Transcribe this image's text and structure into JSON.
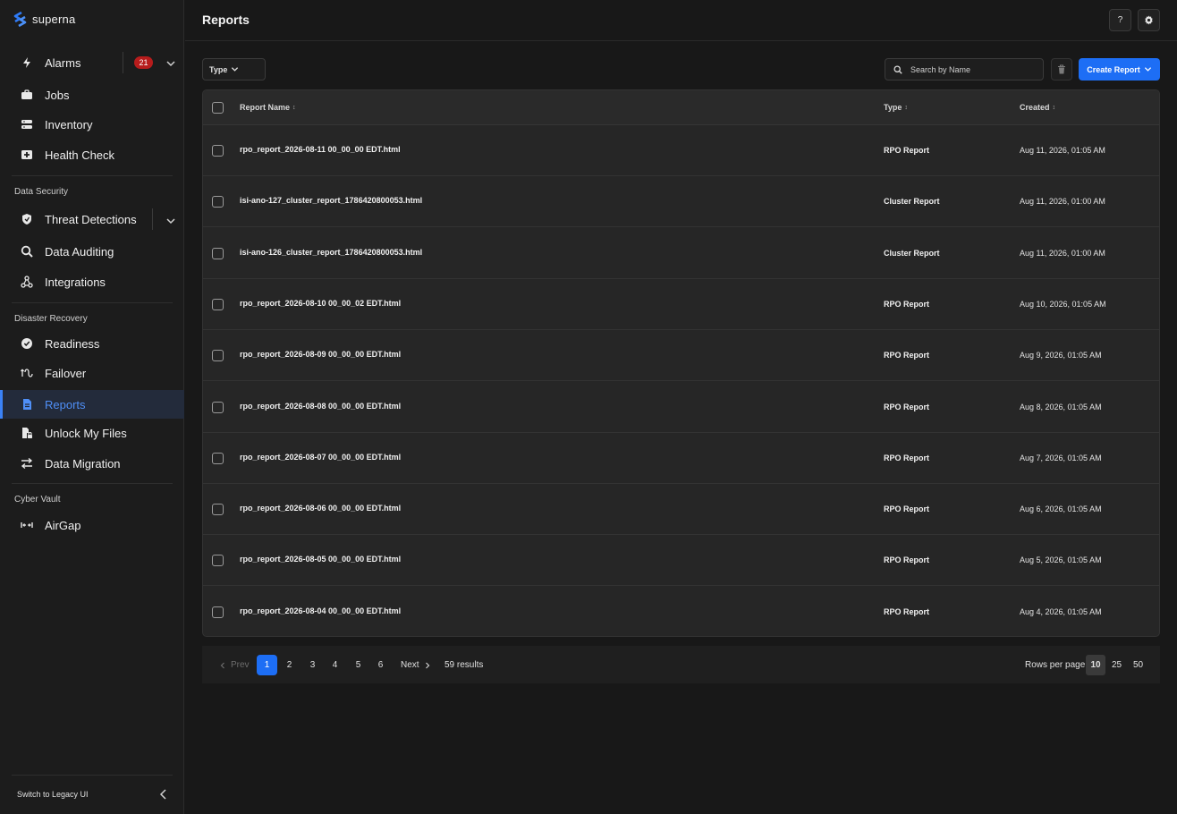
{
  "brand": {
    "name": "superna"
  },
  "sidebar": {
    "items": [
      {
        "label": "Alarms",
        "icon": "lightning-icon",
        "badge": "21"
      },
      {
        "label": "Jobs",
        "icon": "briefcase-icon"
      },
      {
        "label": "Inventory",
        "icon": "server-icon"
      },
      {
        "label": "Health Check",
        "icon": "health-check-icon"
      }
    ],
    "sections": [
      {
        "label": "Data Security",
        "items": [
          {
            "label": "Threat Detections",
            "icon": "shield-icon"
          },
          {
            "label": "Data Auditing",
            "icon": "magnify-icon"
          },
          {
            "label": "Integrations",
            "icon": "integrations-icon"
          }
        ]
      },
      {
        "label": "Disaster Recovery",
        "items": [
          {
            "label": "Readiness",
            "icon": "check-circle-icon"
          },
          {
            "label": "Failover",
            "icon": "failover-icon"
          },
          {
            "label": "Reports",
            "icon": "document-icon",
            "active": true
          },
          {
            "label": "Unlock My Files",
            "icon": "file-lock-icon"
          },
          {
            "label": "Data Migration",
            "icon": "swap-arrows-icon"
          }
        ]
      },
      {
        "label": "Cyber Vault",
        "items": [
          {
            "label": "AirGap",
            "icon": "airgap-icon"
          }
        ]
      }
    ],
    "footer_label": "Switch to Legacy UI"
  },
  "header": {
    "title": "Reports",
    "help_label": "?"
  },
  "toolbar": {
    "type_filter_label": "Type",
    "search_placeholder": "Search by Name",
    "create_label": "Create Report"
  },
  "table": {
    "columns": [
      "Report Name",
      "Type",
      "Created"
    ],
    "rows": [
      {
        "name": "rpo_report_2026-08-11 00_00_00 EDT.html",
        "type": "RPO Report",
        "created": "Aug 11, 2026, 01:05 AM"
      },
      {
        "name": "isi-ano-127_cluster_report_1786420800053.html",
        "type": "Cluster Report",
        "created": "Aug 11, 2026, 01:00 AM"
      },
      {
        "name": "isi-ano-126_cluster_report_1786420800053.html",
        "type": "Cluster Report",
        "created": "Aug 11, 2026, 01:00 AM"
      },
      {
        "name": "rpo_report_2026-08-10 00_00_02 EDT.html",
        "type": "RPO Report",
        "created": "Aug 10, 2026, 01:05 AM"
      },
      {
        "name": "rpo_report_2026-08-09 00_00_00 EDT.html",
        "type": "RPO Report",
        "created": "Aug 9, 2026, 01:05 AM"
      },
      {
        "name": "rpo_report_2026-08-08 00_00_00 EDT.html",
        "type": "RPO Report",
        "created": "Aug 8, 2026, 01:05 AM"
      },
      {
        "name": "rpo_report_2026-08-07 00_00_00 EDT.html",
        "type": "RPO Report",
        "created": "Aug 7, 2026, 01:05 AM"
      },
      {
        "name": "rpo_report_2026-08-06 00_00_00 EDT.html",
        "type": "RPO Report",
        "created": "Aug 6, 2026, 01:05 AM"
      },
      {
        "name": "rpo_report_2026-08-05 00_00_00 EDT.html",
        "type": "RPO Report",
        "created": "Aug 5, 2026, 01:05 AM"
      },
      {
        "name": "rpo_report_2026-08-04 00_00_00 EDT.html",
        "type": "RPO Report",
        "created": "Aug 4, 2026, 01:05 AM"
      }
    ]
  },
  "pagination": {
    "prev_label": "Prev",
    "next_label": "Next",
    "pages": [
      "1",
      "2",
      "3",
      "4",
      "5",
      "6"
    ],
    "current_page": "1",
    "results_text": "59 results",
    "rows_per_page_label": "Rows per page",
    "rows_per_page_options": [
      "10",
      "25",
      "50"
    ],
    "rows_per_page_selected": "10"
  },
  "colors": {
    "accent": "#1d6ef5",
    "badge": "#b71c1c",
    "background": "#181818"
  }
}
